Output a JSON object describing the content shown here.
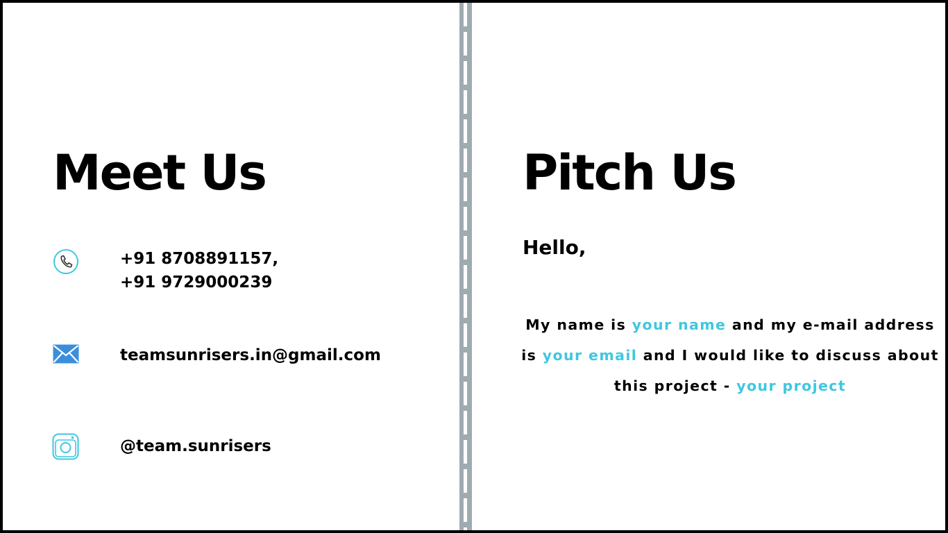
{
  "colors": {
    "accent": "#3fc7e0",
    "divider": "#9eabb1",
    "mail_icon": "#3a8fdc"
  },
  "meet": {
    "title": "Meet Us",
    "phone_icon": "phone-icon",
    "phone_line_1": "+91 8708891157,",
    "phone_line_2": "+91 9729000239",
    "email_icon": "mail-icon",
    "email": "teamsunrisers.in@gmail.com",
    "instagram_icon": "instagram-icon",
    "instagram": "@team.sunrisers"
  },
  "pitch": {
    "title": "Pitch Us",
    "greeting": "Hello,",
    "line1_a": "My name is ",
    "line1_hl": "your name",
    "line1_b": " and my e-mail address",
    "line2_a": "is ",
    "line2_hl": "your email",
    "line2_b": " and I would like to discuss about",
    "line3_a": "this project - ",
    "line3_hl": "your project"
  }
}
